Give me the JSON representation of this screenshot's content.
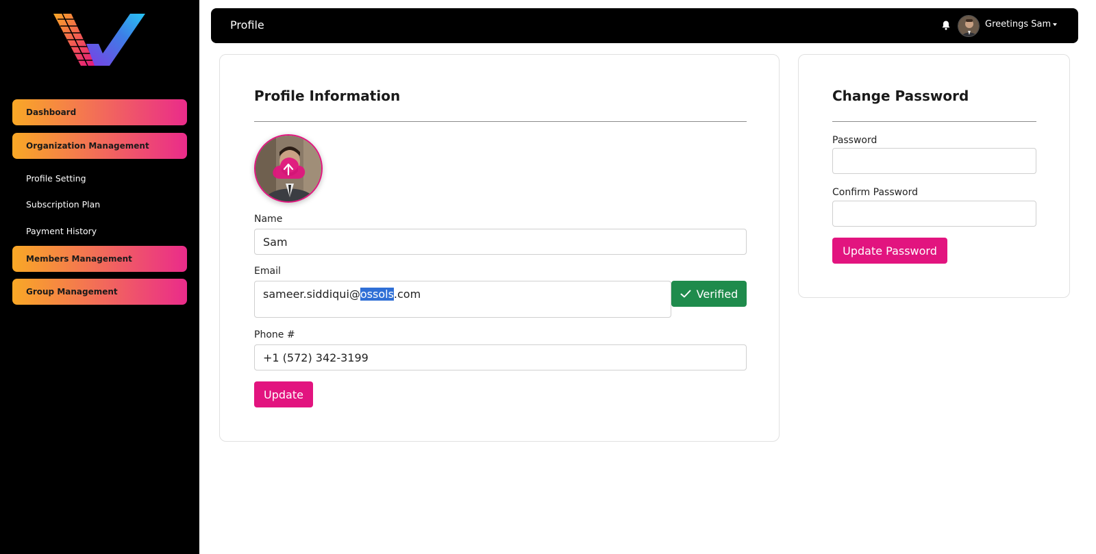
{
  "sidebar": {
    "items": [
      {
        "label": "Dashboard",
        "type": "main"
      },
      {
        "label": "Organization Management",
        "type": "main"
      },
      {
        "label": "Profile Setting",
        "type": "sub"
      },
      {
        "label": "Subscription Plan",
        "type": "sub"
      },
      {
        "label": "Payment History",
        "type": "sub"
      },
      {
        "label": "Members Management",
        "type": "main"
      },
      {
        "label": "Group Management",
        "type": "main"
      }
    ]
  },
  "header": {
    "title": "Profile",
    "greeting": "Greetings Sam",
    "bell_icon": "bell-icon"
  },
  "profile": {
    "title": "Profile Information",
    "name_label": "Name",
    "name_value": "Sam",
    "email_label": "Email",
    "email_prefix": "sameer.siddiqui@",
    "email_selected": "ossols",
    "email_suffix": ".com",
    "verified_label": "Verified",
    "phone_label": "Phone #",
    "phone_value": "+1 (572) 342-3199",
    "update_label": "Update"
  },
  "password": {
    "title": "Change Password",
    "password_label": "Password",
    "confirm_label": "Confirm Password",
    "update_label": "Update Password"
  },
  "colors": {
    "accent": "#e2147f",
    "verified": "#1f8b4c",
    "sidebar_bg": "#000000",
    "nav_gradient_start": "#f9a826",
    "nav_gradient_end": "#ea2b8a"
  }
}
